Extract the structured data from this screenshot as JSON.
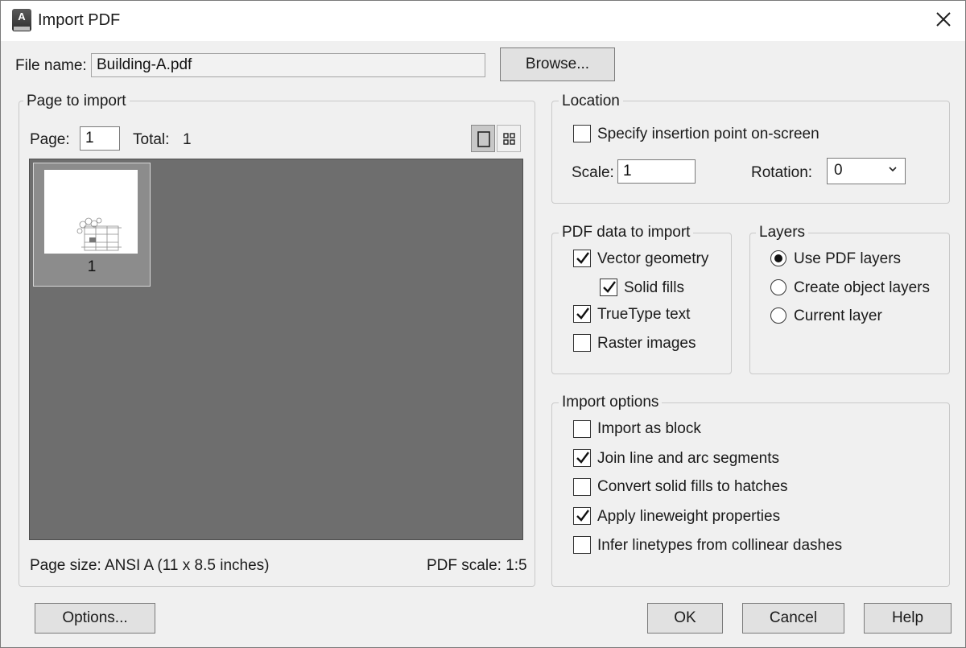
{
  "window": {
    "title": "Import PDF",
    "app_icon_letter": "A"
  },
  "file": {
    "label": "File name:",
    "value": "Building-A.pdf",
    "browse_label": "Browse..."
  },
  "page_to_import": {
    "title": "Page to import",
    "page_label": "Page:",
    "page_value": "1",
    "total_label": "Total:",
    "total_value": "1",
    "thumbnail_label": "1",
    "page_size": "Page size:  ANSI A (11 x 8.5 inches)",
    "pdf_scale": "PDF scale:  1:5"
  },
  "location": {
    "title": "Location",
    "specify_label": "Specify insertion point on-screen",
    "specify_checked": false,
    "scale_label": "Scale:",
    "scale_value": "1",
    "rotation_label": "Rotation:",
    "rotation_value": "0"
  },
  "pdf_data": {
    "title": "PDF data to import",
    "items": [
      {
        "label": "Vector geometry",
        "checked": true
      },
      {
        "label": "Solid fills",
        "checked": true
      },
      {
        "label": "TrueType text",
        "checked": true
      },
      {
        "label": "Raster images",
        "checked": false
      }
    ]
  },
  "layers": {
    "title": "Layers",
    "options": [
      {
        "label": "Use PDF layers",
        "selected": true
      },
      {
        "label": "Create object layers",
        "selected": false
      },
      {
        "label": "Current layer",
        "selected": false
      }
    ]
  },
  "import_options": {
    "title": "Import options",
    "items": [
      {
        "label": "Import as block",
        "checked": false
      },
      {
        "label": "Join line and arc segments",
        "checked": true
      },
      {
        "label": "Convert solid fills to hatches",
        "checked": false
      },
      {
        "label": "Apply lineweight properties",
        "checked": true
      },
      {
        "label": "Infer linetypes from collinear dashes",
        "checked": false
      }
    ]
  },
  "buttons": {
    "options": "Options...",
    "ok": "OK",
    "cancel": "Cancel",
    "help": "Help"
  }
}
